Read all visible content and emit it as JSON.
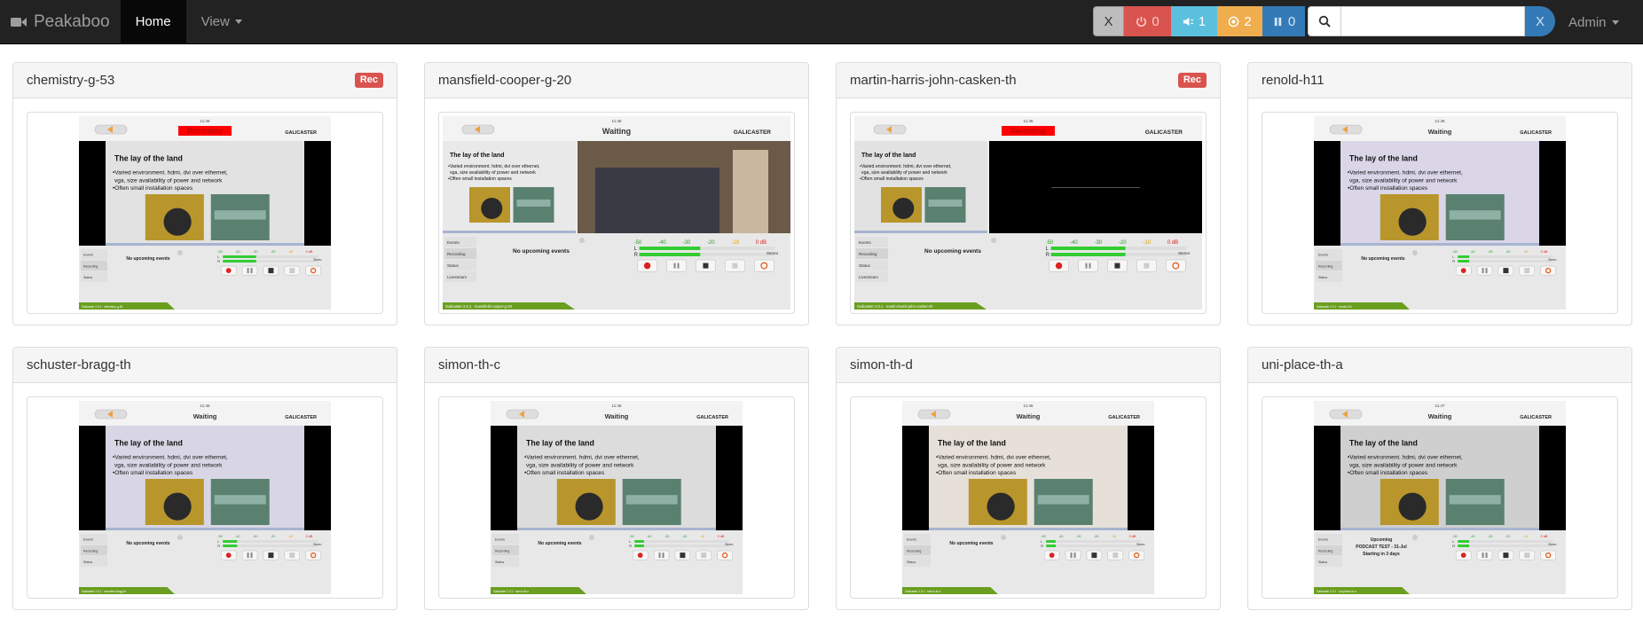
{
  "navbar": {
    "brand": "Peakaboo",
    "home": "Home",
    "view": "View",
    "admin": "Admin"
  },
  "filters": {
    "clear": "X",
    "offline_count": "0",
    "volume_count": "1",
    "recording_count": "2",
    "paused_count": "0"
  },
  "search": {
    "value": "",
    "clear": "X"
  },
  "status_colors": {
    "offline": "#d9534f",
    "volume": "#5bc0de",
    "recording": "#f0ad4e",
    "paused": "#337ab7"
  },
  "agents": [
    {
      "name": "chemistry-g-53",
      "rec": "Rec",
      "time": "11:46",
      "status": "Recording",
      "layout": "single",
      "footer": "Galicaster 2.0.1 · chemistry-g-53"
    },
    {
      "name": "mansfield-cooper-g-20",
      "rec": "",
      "time": "11:46",
      "status": "Waiting",
      "layout": "dual",
      "footer": "Galicaster 2.0.1 · mansfield-cooper-g-20"
    },
    {
      "name": "martin-harris-john-casken-th",
      "rec": "Rec",
      "time": "11:46",
      "status": "Recording",
      "layout": "dual-black",
      "footer": "Galicaster 2.0.1 · martin-harris-john-casken-th"
    },
    {
      "name": "renold-h11",
      "rec": "",
      "time": "11:46",
      "status": "Waiting",
      "layout": "single",
      "footer": "Galicaster 2.0.1 · renold-h11"
    },
    {
      "name": "schuster-bragg-th",
      "rec": "",
      "time": "11:46",
      "status": "Waiting",
      "layout": "single",
      "footer": "Galicaster 2.0.1 · schuster-bragg-th"
    },
    {
      "name": "simon-th-c",
      "rec": "",
      "time": "11:46",
      "status": "Waiting",
      "layout": "single",
      "footer": "Galicaster 2.0.1 · simon-th-c"
    },
    {
      "name": "simon-th-d",
      "rec": "",
      "time": "11:46",
      "status": "Waiting",
      "layout": "single",
      "footer": "Galicaster 2.0.1 · simon-th-d"
    },
    {
      "name": "uni-place-th-a",
      "rec": "",
      "time": "11:47",
      "status": "Waiting",
      "layout": "single",
      "footer": "Galicaster 2.0.1 · uni-place-th-a",
      "upcoming": [
        "Upcoming",
        "PODCAST TEST - 31-Jul",
        "Starting in 3 days"
      ]
    }
  ],
  "screen": {
    "brand": "GALICASTER",
    "slide_title": "The lay of the land",
    "bullet1a": "•Varied environment. hdmi, dvi over ethernet,",
    "bullet1b": "vga, size availability of power and network",
    "bullet2": "•Often small installation spaces",
    "no_events": "No upcoming events",
    "tabs": [
      "Events",
      "Recording",
      "Status",
      "Livestream"
    ],
    "vu_labels": [
      "-50",
      "-40",
      "-30",
      "-20",
      "-10",
      "0 dB"
    ],
    "ch_l": "L",
    "ch_r": "R",
    "stereo": "Stereo"
  }
}
